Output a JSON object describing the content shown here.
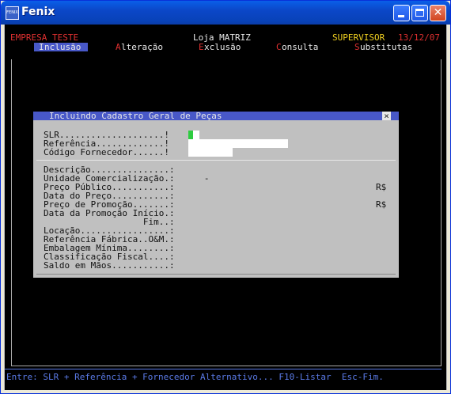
{
  "window": {
    "app_icon_text": "FENIX",
    "title": "Fenix"
  },
  "header": {
    "company": "EMPRESA TESTE",
    "store": "Loja MATRIZ",
    "user": "SUPERVISOR",
    "date": "13/12/07"
  },
  "menu": [
    {
      "hotkey": "I",
      "rest": "nclusão",
      "selected": true
    },
    {
      "hotkey": "A",
      "rest": "lteração",
      "selected": false
    },
    {
      "hotkey": "E",
      "rest": "xclusão",
      "selected": false
    },
    {
      "hotkey": "C",
      "rest": "onsulta",
      "selected": false
    },
    {
      "hotkey": "S",
      "rest": "ubstitutas",
      "selected": false
    }
  ],
  "dialog": {
    "title": "Incluindo Cadastro Geral de Peças",
    "close_glyph": "×",
    "key_fields": [
      {
        "label": "SLR....................!"
      },
      {
        "label": "Referência.............!"
      },
      {
        "label": "Código Fornecedor......!"
      }
    ],
    "fields": [
      {
        "label": "Descrição...............:",
        "value": ""
      },
      {
        "label": "Unidade Comercialização.:",
        "value": "   -"
      },
      {
        "label": "Preço Público...........:",
        "value": "R$"
      },
      {
        "label": "Data do Preço...........:",
        "value": ""
      },
      {
        "label": "Preço de Promoção.......:",
        "value": "R$"
      },
      {
        "label": "Data da Promoção Início.:",
        "value": ""
      },
      {
        "label": "                   Fim..:",
        "value": ""
      },
      {
        "label": "Locação.................:",
        "value": ""
      },
      {
        "label": "Referência Fábrica..O&M.:",
        "value": ""
      },
      {
        "label": "Embalagem Mínima........:",
        "value": ""
      },
      {
        "label": "Classificação Fiscal....:",
        "value": ""
      },
      {
        "label": "Saldo em Mãos...........:",
        "value": ""
      }
    ]
  },
  "status_bar": {
    "text": "Entre: SLR + Referência + Fornecedor Alternativo... F10-Listar  Esc-Fim."
  },
  "colors": {
    "console_bg": "#000000",
    "dialog_bg": "#C0C0C0",
    "accent_blue": "#4858C8",
    "hotkey_red": "#E03030",
    "user_yellow": "#F0D020",
    "cursor_green": "#2ECC40"
  }
}
